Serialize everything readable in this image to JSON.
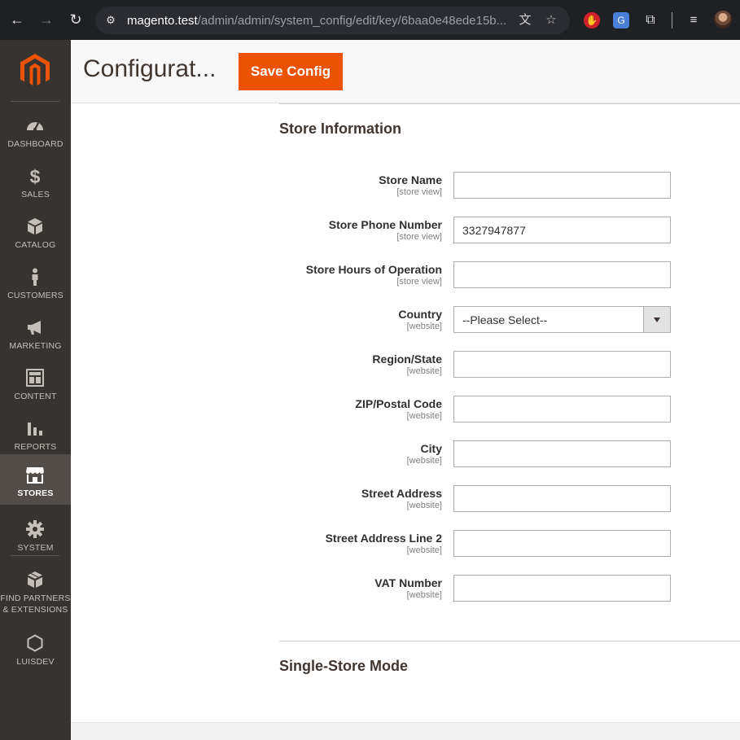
{
  "browser": {
    "url_host": "magento.test",
    "url_path": "/admin/admin/system_config/edit/key/6baa0e48ede15b..."
  },
  "sidebar": {
    "items": [
      {
        "label": "DASHBOARD",
        "icon": "dashboard-icon"
      },
      {
        "label": "SALES",
        "icon": "dollar-icon"
      },
      {
        "label": "CATALOG",
        "icon": "box-icon"
      },
      {
        "label": "CUSTOMERS",
        "icon": "person-icon"
      },
      {
        "label": "MARKETING",
        "icon": "megaphone-icon"
      },
      {
        "label": "CONTENT",
        "icon": "layout-icon"
      },
      {
        "label": "REPORTS",
        "icon": "bar-chart-icon"
      },
      {
        "label": "STORES",
        "icon": "storefront-icon",
        "active": true
      },
      {
        "label": "SYSTEM",
        "icon": "gear-icon"
      },
      {
        "label": "FIND PARTNERS",
        "label2": "& EXTENSIONS",
        "icon": "blocks-icon"
      },
      {
        "label": "LUISDEV",
        "icon": "hexagon-icon"
      }
    ]
  },
  "header": {
    "title": "Configurat...",
    "save_label": "Save Config"
  },
  "sections": {
    "store_info_title": "Store Information",
    "single_store_title": "Single-Store Mode"
  },
  "fields": [
    {
      "label": "Store Name",
      "scope": "[store view]",
      "value": ""
    },
    {
      "label": "Store Phone Number",
      "scope": "[store view]",
      "value": "3327947877"
    },
    {
      "label": "Store Hours of Operation",
      "scope": "[store view]",
      "value": ""
    },
    {
      "label": "Country",
      "scope": "[website]",
      "value": "--Please Select--"
    },
    {
      "label": "Region/State",
      "scope": "[website]",
      "value": ""
    },
    {
      "label": "ZIP/Postal Code",
      "scope": "[website]",
      "value": ""
    },
    {
      "label": "City",
      "scope": "[website]",
      "value": ""
    },
    {
      "label": "Street Address",
      "scope": "[website]",
      "value": ""
    },
    {
      "label": "Street Address Line 2",
      "scope": "[website]",
      "value": ""
    },
    {
      "label": "VAT Number",
      "scope": "[website]",
      "value": ""
    }
  ],
  "colors": {
    "accent": "#eb5202",
    "sidebar_bg": "#373330",
    "sidebar_active": "#524d49"
  }
}
